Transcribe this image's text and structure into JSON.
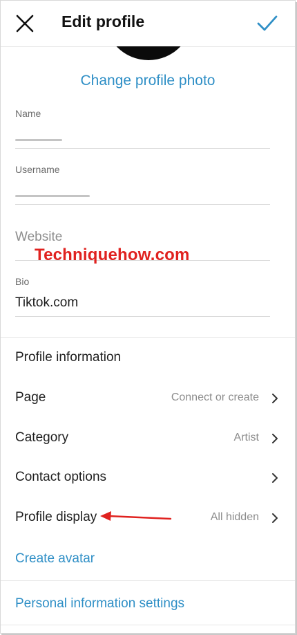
{
  "header": {
    "title": "Edit profile",
    "close_icon": "close-icon",
    "confirm_icon": "checkmark-icon"
  },
  "profile_photo": {
    "change_label": "Change profile photo"
  },
  "fields": {
    "name": {
      "label": "Name"
    },
    "username": {
      "label": "Username"
    },
    "website": {
      "placeholder": "Website"
    },
    "bio": {
      "label": "Bio",
      "value": "Tiktok.com"
    }
  },
  "watermark": "Techniquehow.com",
  "profile_information": {
    "heading": "Profile information",
    "rows": [
      {
        "label": "Page",
        "value": "Connect or create"
      },
      {
        "label": "Category",
        "value": "Artist"
      },
      {
        "label": "Contact options",
        "value": ""
      },
      {
        "label": "Profile display",
        "value": "All hidden"
      }
    ]
  },
  "links": {
    "create_avatar": "Create avatar",
    "personal_info": "Personal information settings"
  },
  "colors": {
    "accent": "#2f8fc6",
    "watermark": "#e0221f",
    "annotation_arrow": "#e0221f"
  }
}
